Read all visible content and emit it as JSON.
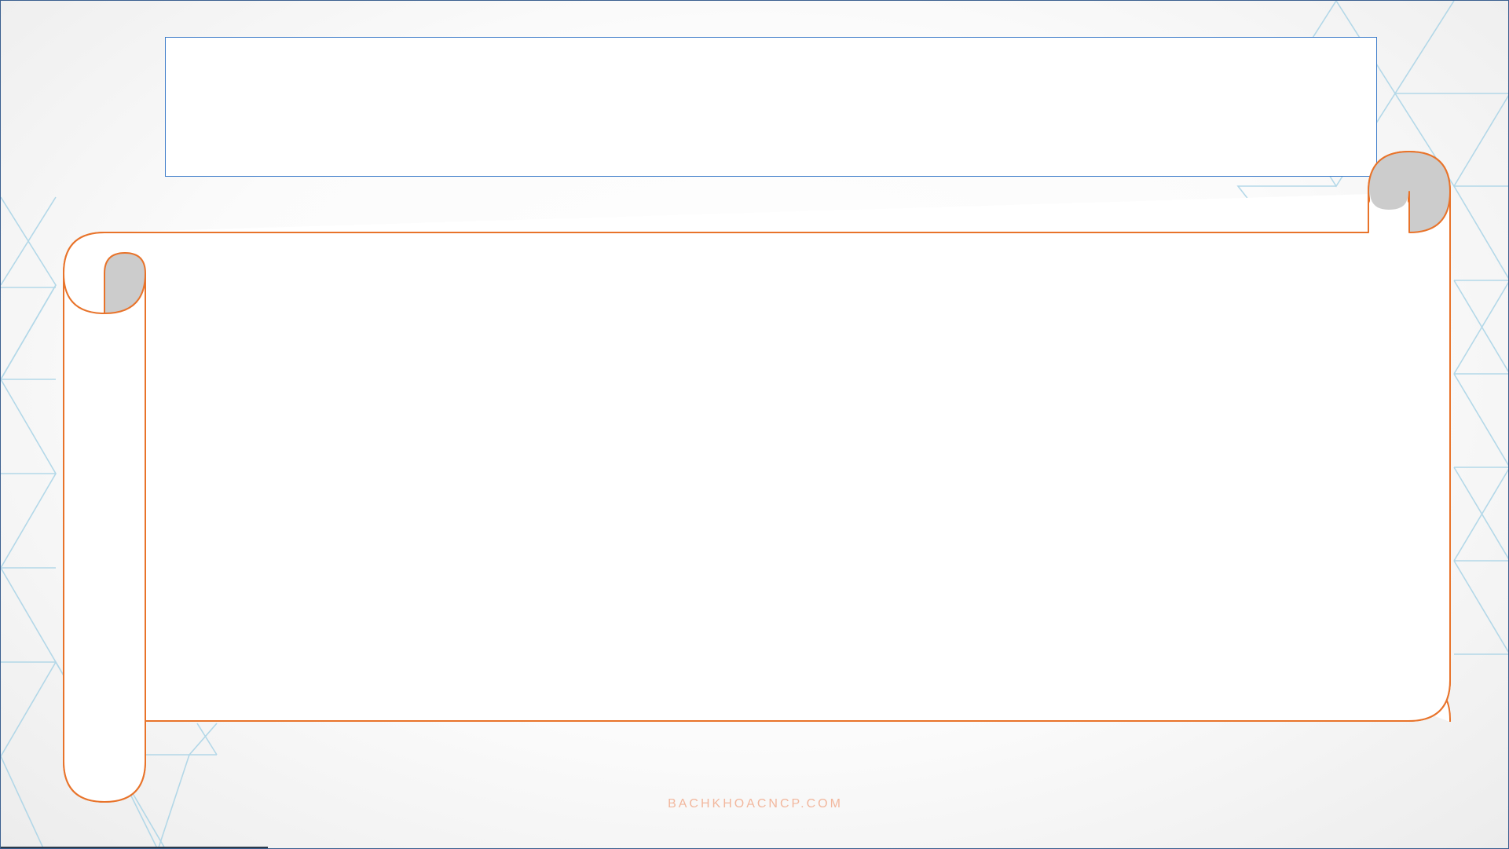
{
  "slide": {
    "title_text": "",
    "scroll_text": "",
    "watermark": "BACHKHOACNCP.COM"
  },
  "colors": {
    "scroll_stroke": "#e8732a",
    "scroll_curl_fill": "#cccccc",
    "title_border": "#3d7cc9",
    "pattern_stroke": "#a8d3e6",
    "watermark": "#f2b79d"
  },
  "icons": {
    "background": "triangle-pattern",
    "banner": "parchment-scroll"
  }
}
